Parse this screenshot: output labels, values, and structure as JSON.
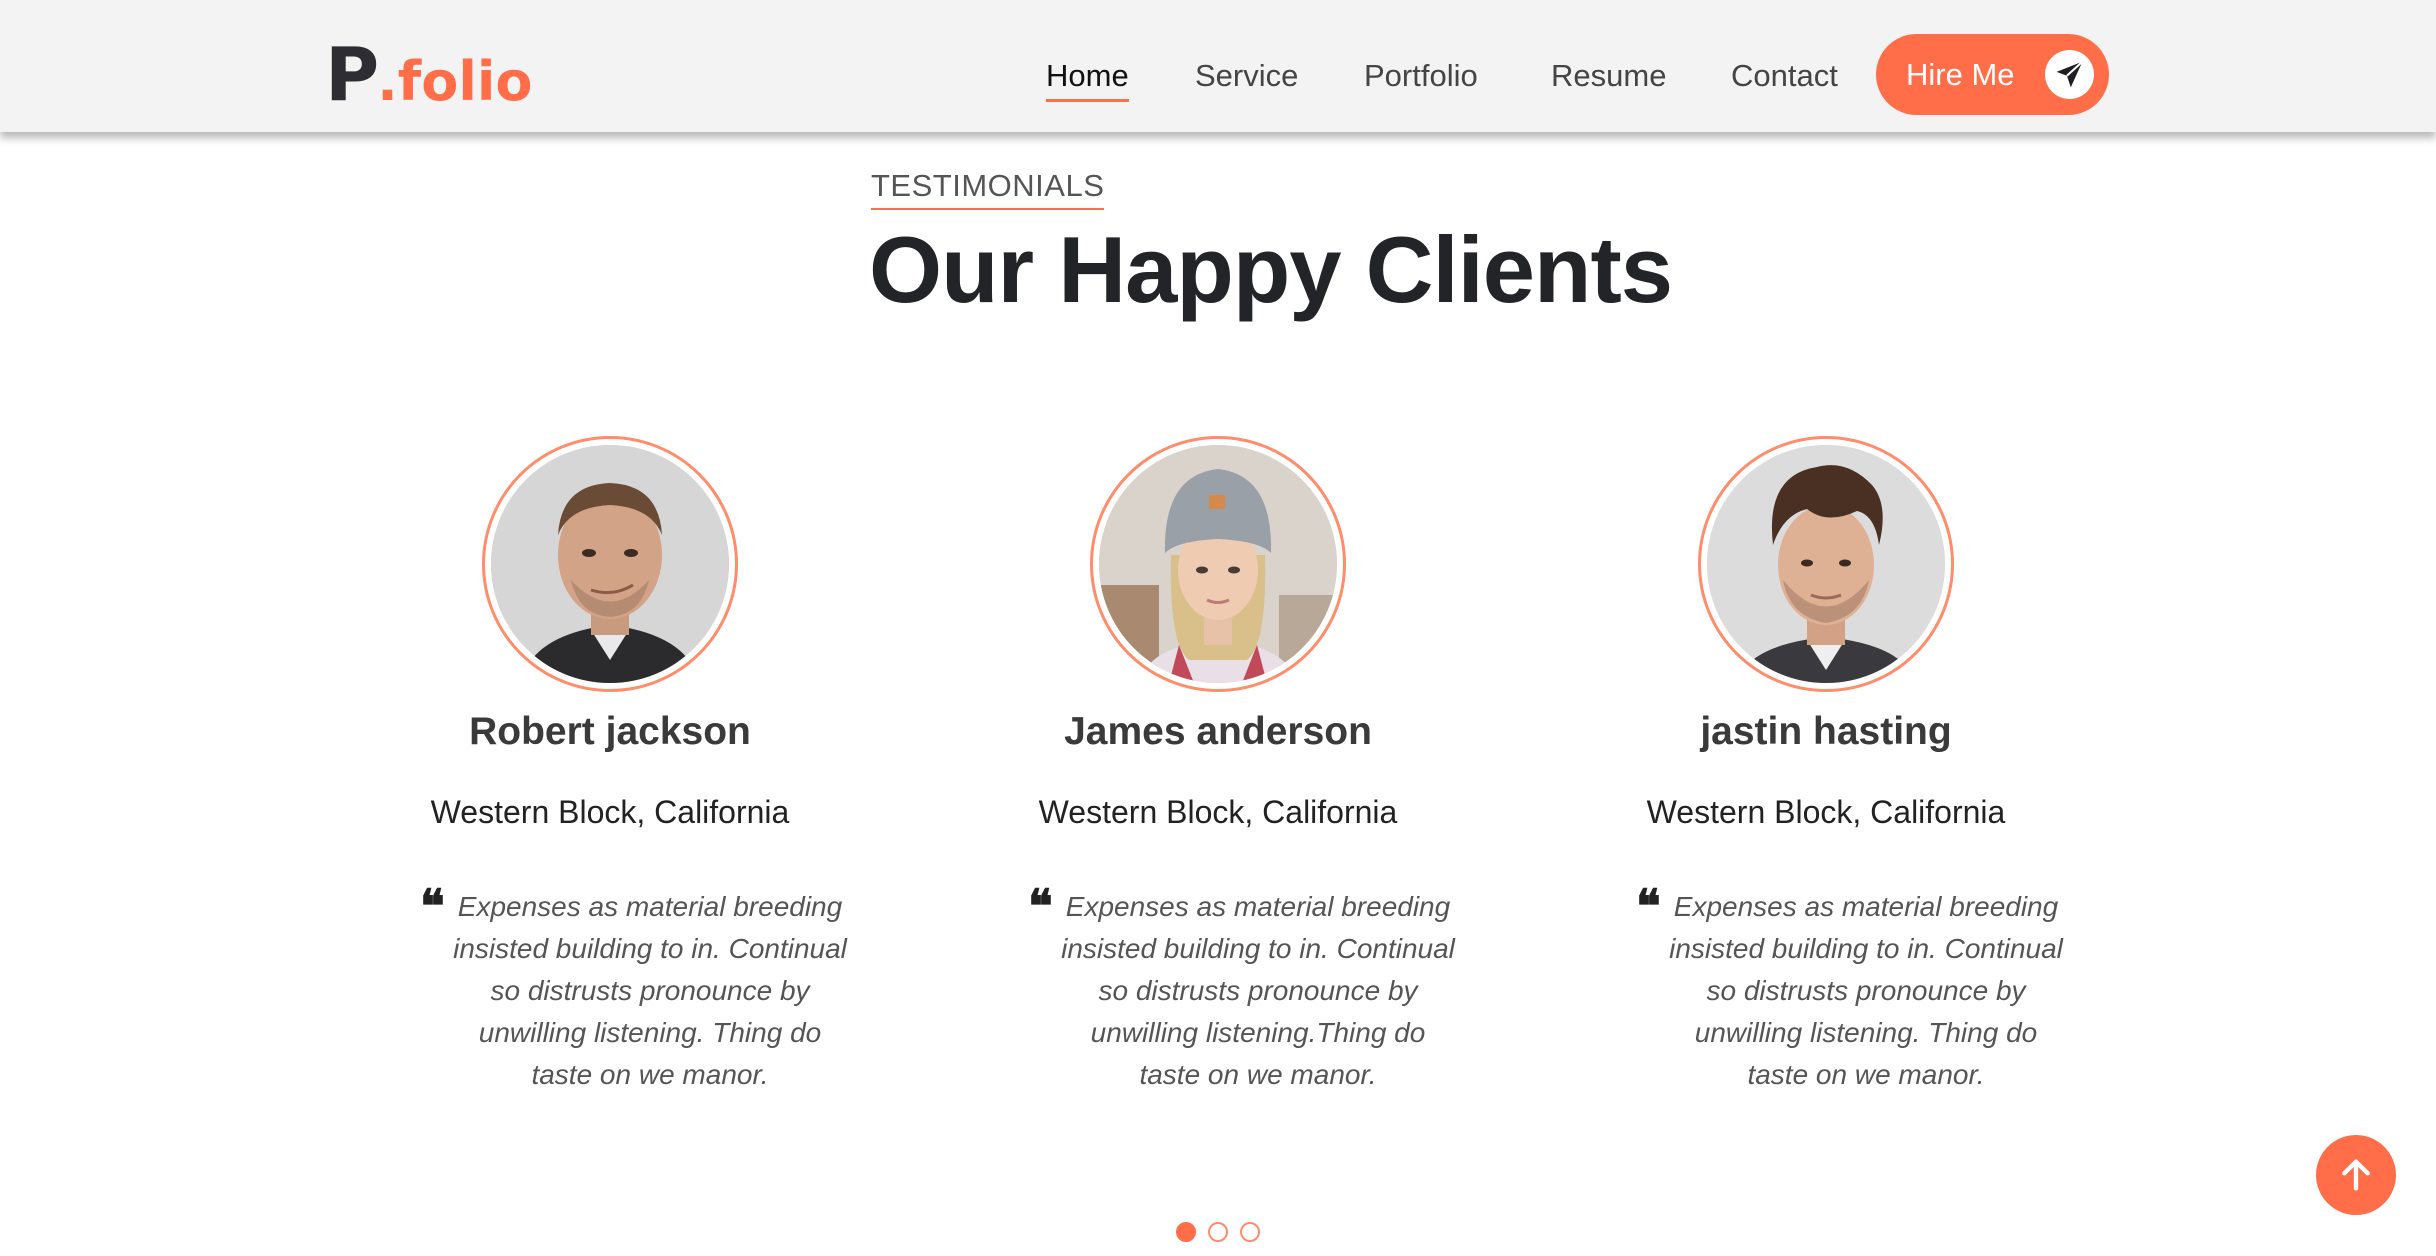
{
  "header": {
    "logo_p": "P",
    "logo_rest": ".folio",
    "nav": [
      {
        "label": "Home",
        "active": true
      },
      {
        "label": "Service",
        "active": false
      },
      {
        "label": "Portfolio",
        "active": false
      },
      {
        "label": "Resume",
        "active": false
      },
      {
        "label": "Contact",
        "active": false
      }
    ],
    "hire_label": "Hire Me",
    "hire_icon": "paper-plane-icon"
  },
  "section": {
    "eyebrow": "TESTIMONIALS",
    "title": "Our Happy Clients"
  },
  "testimonials": [
    {
      "name": "Robert jackson",
      "location": "Western Block, California",
      "quote": "Expenses as material breeding insisted building to in. Continual so distrusts pronounce by unwilling listening. Thing do taste on we manor.",
      "avatar": "man-smirking-photo"
    },
    {
      "name": "James anderson",
      "location": "Western Block, California",
      "quote": "Expenses as material breeding insisted building to in. Continual so distrusts pronounce by unwilling listening.Thing do taste on we manor.",
      "avatar": "woman-beanie-photo"
    },
    {
      "name": "jastin hasting",
      "location": "Western Block, California",
      "quote": "Expenses as material breeding insisted building to in. Continual so distrusts pronounce by unwilling listening. Thing do taste on we manor.",
      "avatar": "man-curly-hair-photo"
    }
  ],
  "pagination": {
    "pages": 3,
    "current": 1
  },
  "scroll_top_icon": "arrow-up-icon",
  "colors": {
    "accent": "#ff6e48",
    "header_bg": "#f3f3f3",
    "title": "#222428"
  }
}
